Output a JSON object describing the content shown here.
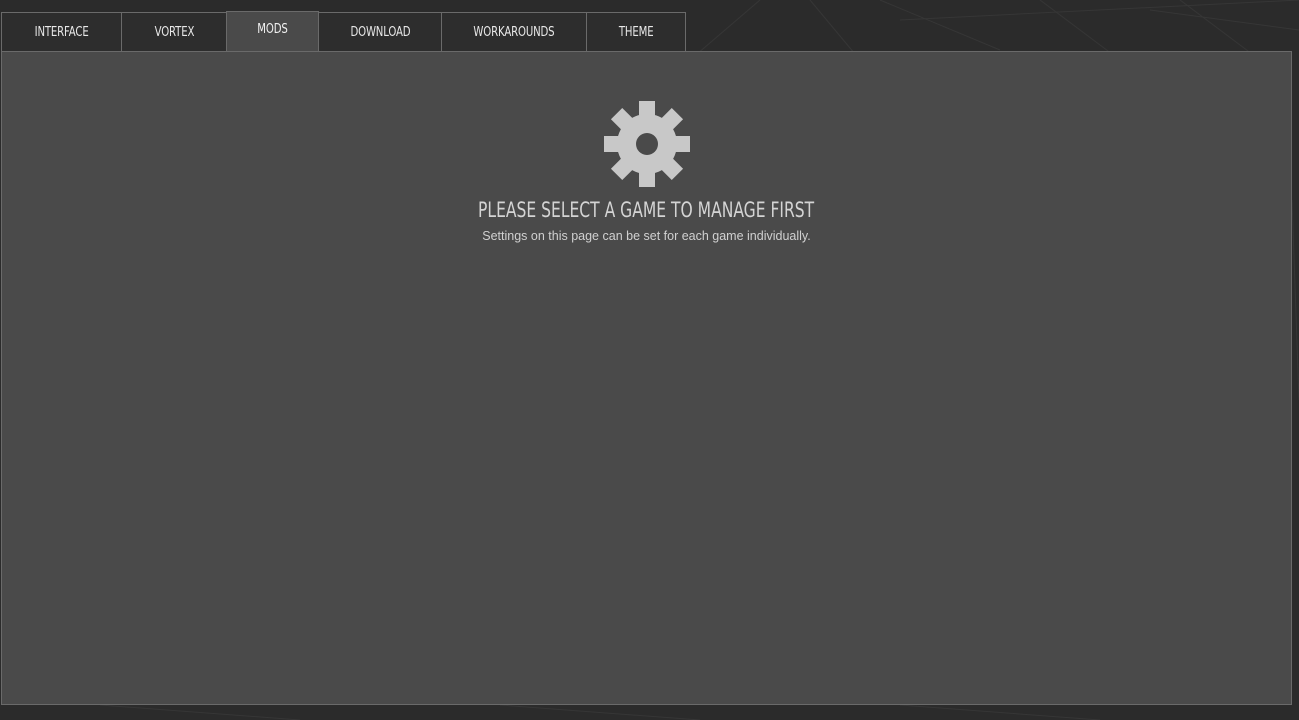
{
  "tabs": [
    {
      "label": "INTERFACE",
      "active": false
    },
    {
      "label": "VORTEX",
      "active": false
    },
    {
      "label": "MODS",
      "active": true
    },
    {
      "label": "DOWNLOAD",
      "active": false
    },
    {
      "label": "WORKAROUNDS",
      "active": false
    },
    {
      "label": "THEME",
      "active": false
    }
  ],
  "empty_state": {
    "icon": "gear-icon",
    "title": "PLEASE SELECT A GAME TO MANAGE FIRST",
    "subtitle": "Settings on this page can be set for each game individually."
  },
  "colors": {
    "background": "#2b2b2b",
    "panel": "#4a4a4a",
    "tab": "#2d2d2d",
    "border": "#6a6a6a",
    "icon": "#c8c8c8"
  }
}
